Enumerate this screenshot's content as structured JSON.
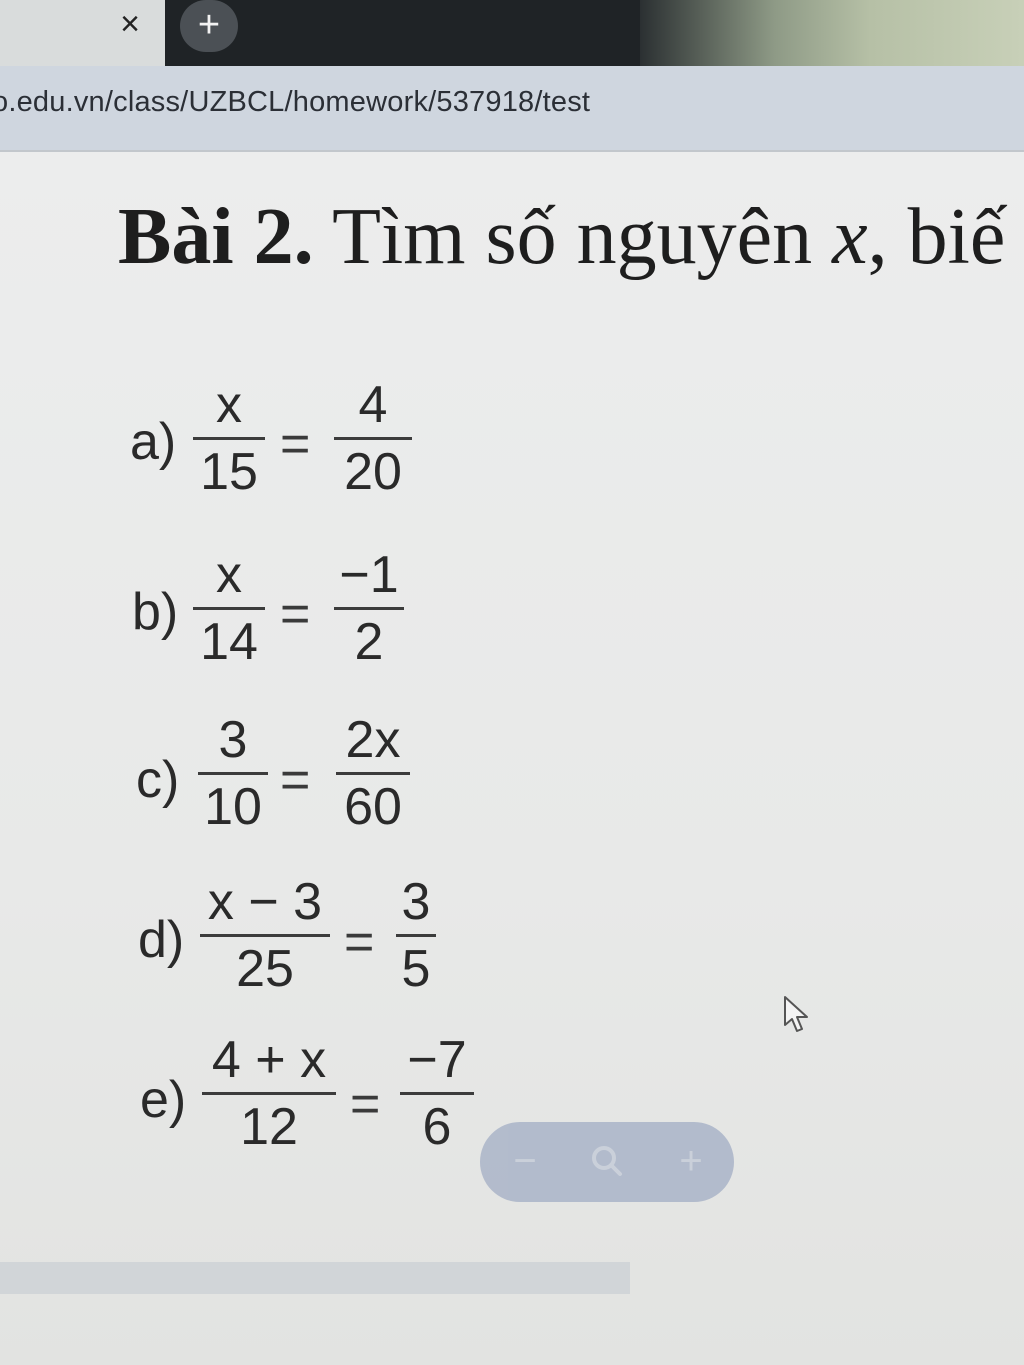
{
  "browser": {
    "tab_close": "×",
    "new_tab": "+",
    "url": "o.edu.vn/class/UZBCL/homework/537918/test"
  },
  "heading": {
    "bold": "Bài 2.",
    "text_before_var": "Tìm số nguyên",
    "var": "x",
    "text_after_var": ", biế"
  },
  "problems": [
    {
      "label": "a)",
      "left_num": "x",
      "left_den": "15",
      "right_num": "4",
      "right_den": "20"
    },
    {
      "label": "b)",
      "left_num": "x",
      "left_den": "14",
      "right_num": "−1",
      "right_den": "2"
    },
    {
      "label": "c)",
      "left_num": "3",
      "left_den": "10",
      "right_num": "2x",
      "right_den": "60"
    },
    {
      "label": "d)",
      "left_num": "x − 3",
      "left_den": "25",
      "right_num": "3",
      "right_den": "5"
    },
    {
      "label": "e)",
      "left_num": "4 + x",
      "left_den": "12",
      "right_num": "−7",
      "right_den": "6"
    }
  ],
  "equals": "=",
  "zoom": {
    "minus": "−",
    "search_icon": "magnifier-icon",
    "plus": "+"
  }
}
